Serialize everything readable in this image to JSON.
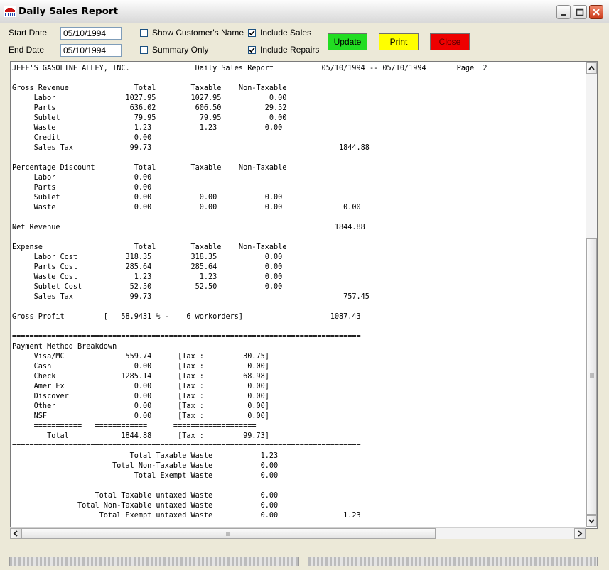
{
  "window": {
    "title": "Daily Sales Report",
    "app_icon": "aims-logo-icon"
  },
  "filters": {
    "start_date_label": "Start Date",
    "start_date_value": "05/10/1994",
    "end_date_label": "End Date",
    "end_date_value": "05/10/1994",
    "show_customer_name": {
      "label": "Show Customer's Name",
      "checked": false
    },
    "summary_only": {
      "label": "Summary Only",
      "checked": false
    },
    "include_sales": {
      "label": "Include Sales",
      "checked": true
    },
    "include_repairs": {
      "label": "Include Repairs",
      "checked": true
    }
  },
  "buttons": {
    "update": {
      "label": "Update",
      "color": "#22dd22"
    },
    "print": {
      "label": "Print",
      "color": "#ffff00"
    },
    "close": {
      "label": "Close",
      "color": "#ee0000"
    }
  },
  "report": {
    "lines": [
      "JEFF'S GASOLINE ALLEY, INC.               Daily Sales Report           05/10/1994 -- 05/10/1994       Page  2",
      "",
      "Gross Revenue               Total        Taxable    Non-Taxable",
      "     Labor                1027.95        1027.95           0.00",
      "     Parts                 636.02         606.50          29.52",
      "     Sublet                 79.95          79.95           0.00",
      "     Waste                  1.23           1.23           0.00",
      "     Credit                 0.00",
      "     Sales Tax             99.73                                           1844.88",
      "",
      "Percentage Discount         Total        Taxable    Non-Taxable",
      "     Labor                  0.00",
      "     Parts                  0.00",
      "     Sublet                 0.00           0.00           0.00",
      "     Waste                  0.00           0.00           0.00              0.00",
      "",
      "Net Revenue                                                               1844.88",
      "",
      "Expense                     Total        Taxable    Non-Taxable",
      "     Labor Cost           318.35         318.35           0.00",
      "     Parts Cost           285.64         285.64           0.00",
      "     Waste Cost             1.23           1.23           0.00",
      "     Sublet Cost           52.50          52.50           0.00",
      "     Sales Tax             99.73                                            757.45",
      "",
      "Gross Profit         [   58.9431 % -    6 workorders]                    1087.43",
      "",
      "================================================================================",
      "Payment Method Breakdown",
      "     Visa/MC              559.74      [Tax :         30.75]",
      "     Cash                   0.00      [Tax :          0.00]",
      "     Check               1285.14      [Tax :         68.98]",
      "     Amer Ex                0.00      [Tax :          0.00]",
      "     Discover               0.00      [Tax :          0.00]",
      "     Other                  0.00      [Tax :          0.00]",
      "     NSF                    0.00      [Tax :          0.00]",
      "     ===========   ============      ===================",
      "        Total            1844.88      [Tax :         99.73]",
      "================================================================================",
      "                           Total Taxable Waste           1.23",
      "                       Total Non-Taxable Waste           0.00",
      "                            Total Exempt Waste           0.00",
      "",
      "                   Total Taxable untaxed Waste           0.00",
      "               Total Non-Taxable untaxed Waste           0.00",
      "                    Total Exempt untaxed Waste           0.00               1.23"
    ]
  }
}
